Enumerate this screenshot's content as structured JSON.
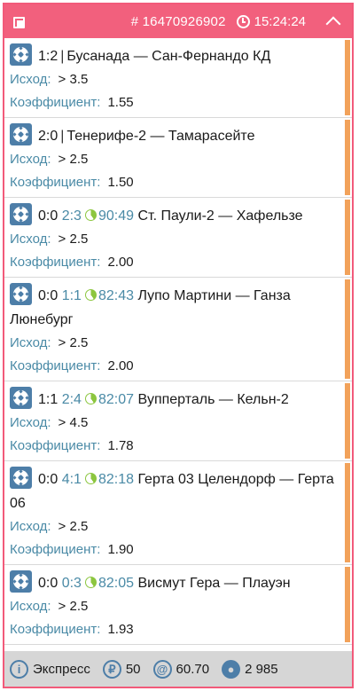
{
  "header": {
    "bet_id": "# 16470926902",
    "time": "15:24:24",
    "icons": [
      "copy-icon",
      "clock-icon",
      "chevron-up-icon"
    ]
  },
  "labels": {
    "outcome": "Исход:",
    "coefficient": "Коэффициент:"
  },
  "events": [
    {
      "score": "1:2",
      "live_score": "",
      "clock": "",
      "teams": "Бусанада — Сан-Фернандо КД",
      "outcome": "> 3.5",
      "coef": "1.55"
    },
    {
      "score": "2:0",
      "live_score": "",
      "clock": "",
      "teams": "Тенерифе-2 — Тамарасейте",
      "outcome": "> 2.5",
      "coef": "1.50"
    },
    {
      "score": "0:0",
      "live_score": "2:3",
      "clock": "90:49",
      "teams": "Ст. Паули-2 — Хафельзе",
      "outcome": "> 2.5",
      "coef": "2.00"
    },
    {
      "score": "0:0",
      "live_score": "1:1",
      "clock": "82:43",
      "teams": "Лупо Мартини — Ганза Люнебург",
      "outcome": "> 2.5",
      "coef": "2.00"
    },
    {
      "score": "1:1",
      "live_score": "2:4",
      "clock": "82:07",
      "teams": "Вупперталь — Кельн-2",
      "outcome": "> 4.5",
      "coef": "1.78"
    },
    {
      "score": "0:0",
      "live_score": "4:1",
      "clock": "82:18",
      "teams": "Герта 03 Целендорф — Герта 06",
      "outcome": "> 2.5",
      "coef": "1.90"
    },
    {
      "score": "0:0",
      "live_score": "0:3",
      "clock": "82:05",
      "teams": "Висмут Гера — Плауэн",
      "outcome": "> 2.5",
      "coef": "1.93"
    }
  ],
  "footer": {
    "type": "Экспресс",
    "stake": "50",
    "total_coef": "60.70",
    "payout": "2 985"
  },
  "colors": {
    "header": "#f2607d",
    "accent_bar": "#f2a25a",
    "label": "#4a8aa6",
    "icon": "#4d7ea8",
    "footer": "#d6d6d6"
  }
}
